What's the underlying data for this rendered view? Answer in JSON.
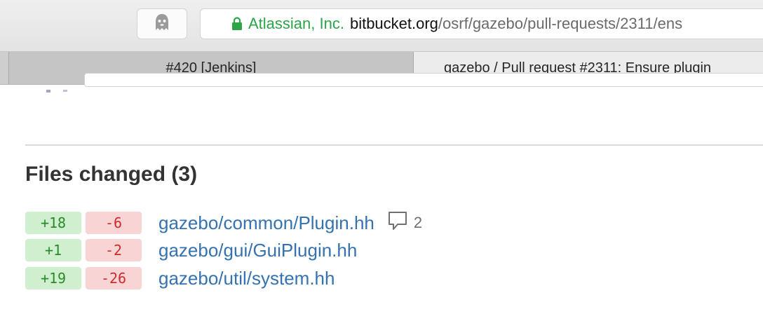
{
  "browser": {
    "extension_icon": "ghost-icon",
    "address": {
      "lock_icon": "lock-icon",
      "organization": "Atlassian, Inc.",
      "domain": "bitbucket.org",
      "path": "/osrf/gazebo/pull-requests/2311/ens"
    },
    "tabs": [
      {
        "label": "#420 [Jenkins]",
        "active": false
      },
      {
        "label": "gazebo / Pull request #2311: Ensure plugin",
        "active": true
      }
    ]
  },
  "files_changed": {
    "heading": "Files changed (3)",
    "files": [
      {
        "added": "+18",
        "removed": "-6",
        "path": "gazebo/common/Plugin.hh",
        "comments": "2"
      },
      {
        "added": "+1",
        "removed": "-2",
        "path": "gazebo/gui/GuiPlugin.hh"
      },
      {
        "added": "+19",
        "removed": "-26",
        "path": "gazebo/util/system.hh"
      }
    ]
  },
  "colors": {
    "secure_green": "#2aa548",
    "link_blue": "#3572b0",
    "added_bg": "#cfefcf",
    "added_text": "#2a8a2a",
    "removed_bg": "#f8d4d4",
    "removed_text": "#cc2c2c"
  }
}
